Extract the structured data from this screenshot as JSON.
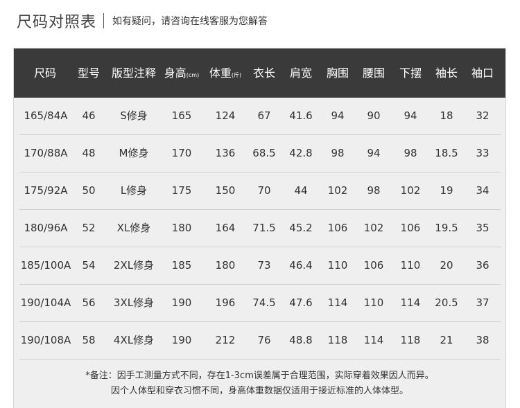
{
  "header": {
    "title": "尺码对照表",
    "subtitle": "如有疑问，请咨询在线客服为您解答"
  },
  "table": {
    "columns": [
      {
        "label": "尺码",
        "unit": ""
      },
      {
        "label": "型号",
        "unit": ""
      },
      {
        "label": "版型注释",
        "unit": ""
      },
      {
        "label": "身高",
        "unit": "(cm)"
      },
      {
        "label": "体重",
        "unit": "(斤)"
      },
      {
        "label": "衣长",
        "unit": ""
      },
      {
        "label": "肩宽",
        "unit": ""
      },
      {
        "label": "胸围",
        "unit": ""
      },
      {
        "label": "腰围",
        "unit": ""
      },
      {
        "label": "下摆",
        "unit": ""
      },
      {
        "label": "袖长",
        "unit": ""
      },
      {
        "label": "袖口",
        "unit": ""
      }
    ],
    "rows": [
      [
        "165/84A",
        "46",
        "S修身",
        "165",
        "124",
        "67",
        "41.6",
        "94",
        "90",
        "94",
        "18",
        "32"
      ],
      [
        "170/88A",
        "48",
        "M修身",
        "170",
        "136",
        "68.5",
        "42.8",
        "98",
        "94",
        "98",
        "18.5",
        "33"
      ],
      [
        "175/92A",
        "50",
        "L修身",
        "175",
        "150",
        "70",
        "44",
        "102",
        "98",
        "102",
        "19",
        "34"
      ],
      [
        "180/96A",
        "52",
        "XL修身",
        "180",
        "164",
        "71.5",
        "45.2",
        "106",
        "102",
        "106",
        "19.5",
        "35"
      ],
      [
        "185/100A",
        "54",
        "2XL修身",
        "185",
        "180",
        "73",
        "46.4",
        "110",
        "106",
        "110",
        "20",
        "36"
      ],
      [
        "190/104A",
        "56",
        "3XL修身",
        "190",
        "196",
        "74.5",
        "47.6",
        "114",
        "110",
        "114",
        "20.5",
        "37"
      ],
      [
        "190/108A",
        "58",
        "4XL修身",
        "190",
        "212",
        "76",
        "48.8",
        "118",
        "114",
        "118",
        "21",
        "38"
      ]
    ]
  },
  "notes": {
    "line1": "*备注：因手工测量方式不同，存在1-3cm误差属于合理范围，实际穿着效果因人而异。",
    "line2": "因个人体型和穿衣习惯不同，身高体重数据仅适用于接近标准的人体体型。"
  },
  "colors": {
    "header_bg": "#3a3a3a",
    "panel_bg": "#efefef"
  }
}
